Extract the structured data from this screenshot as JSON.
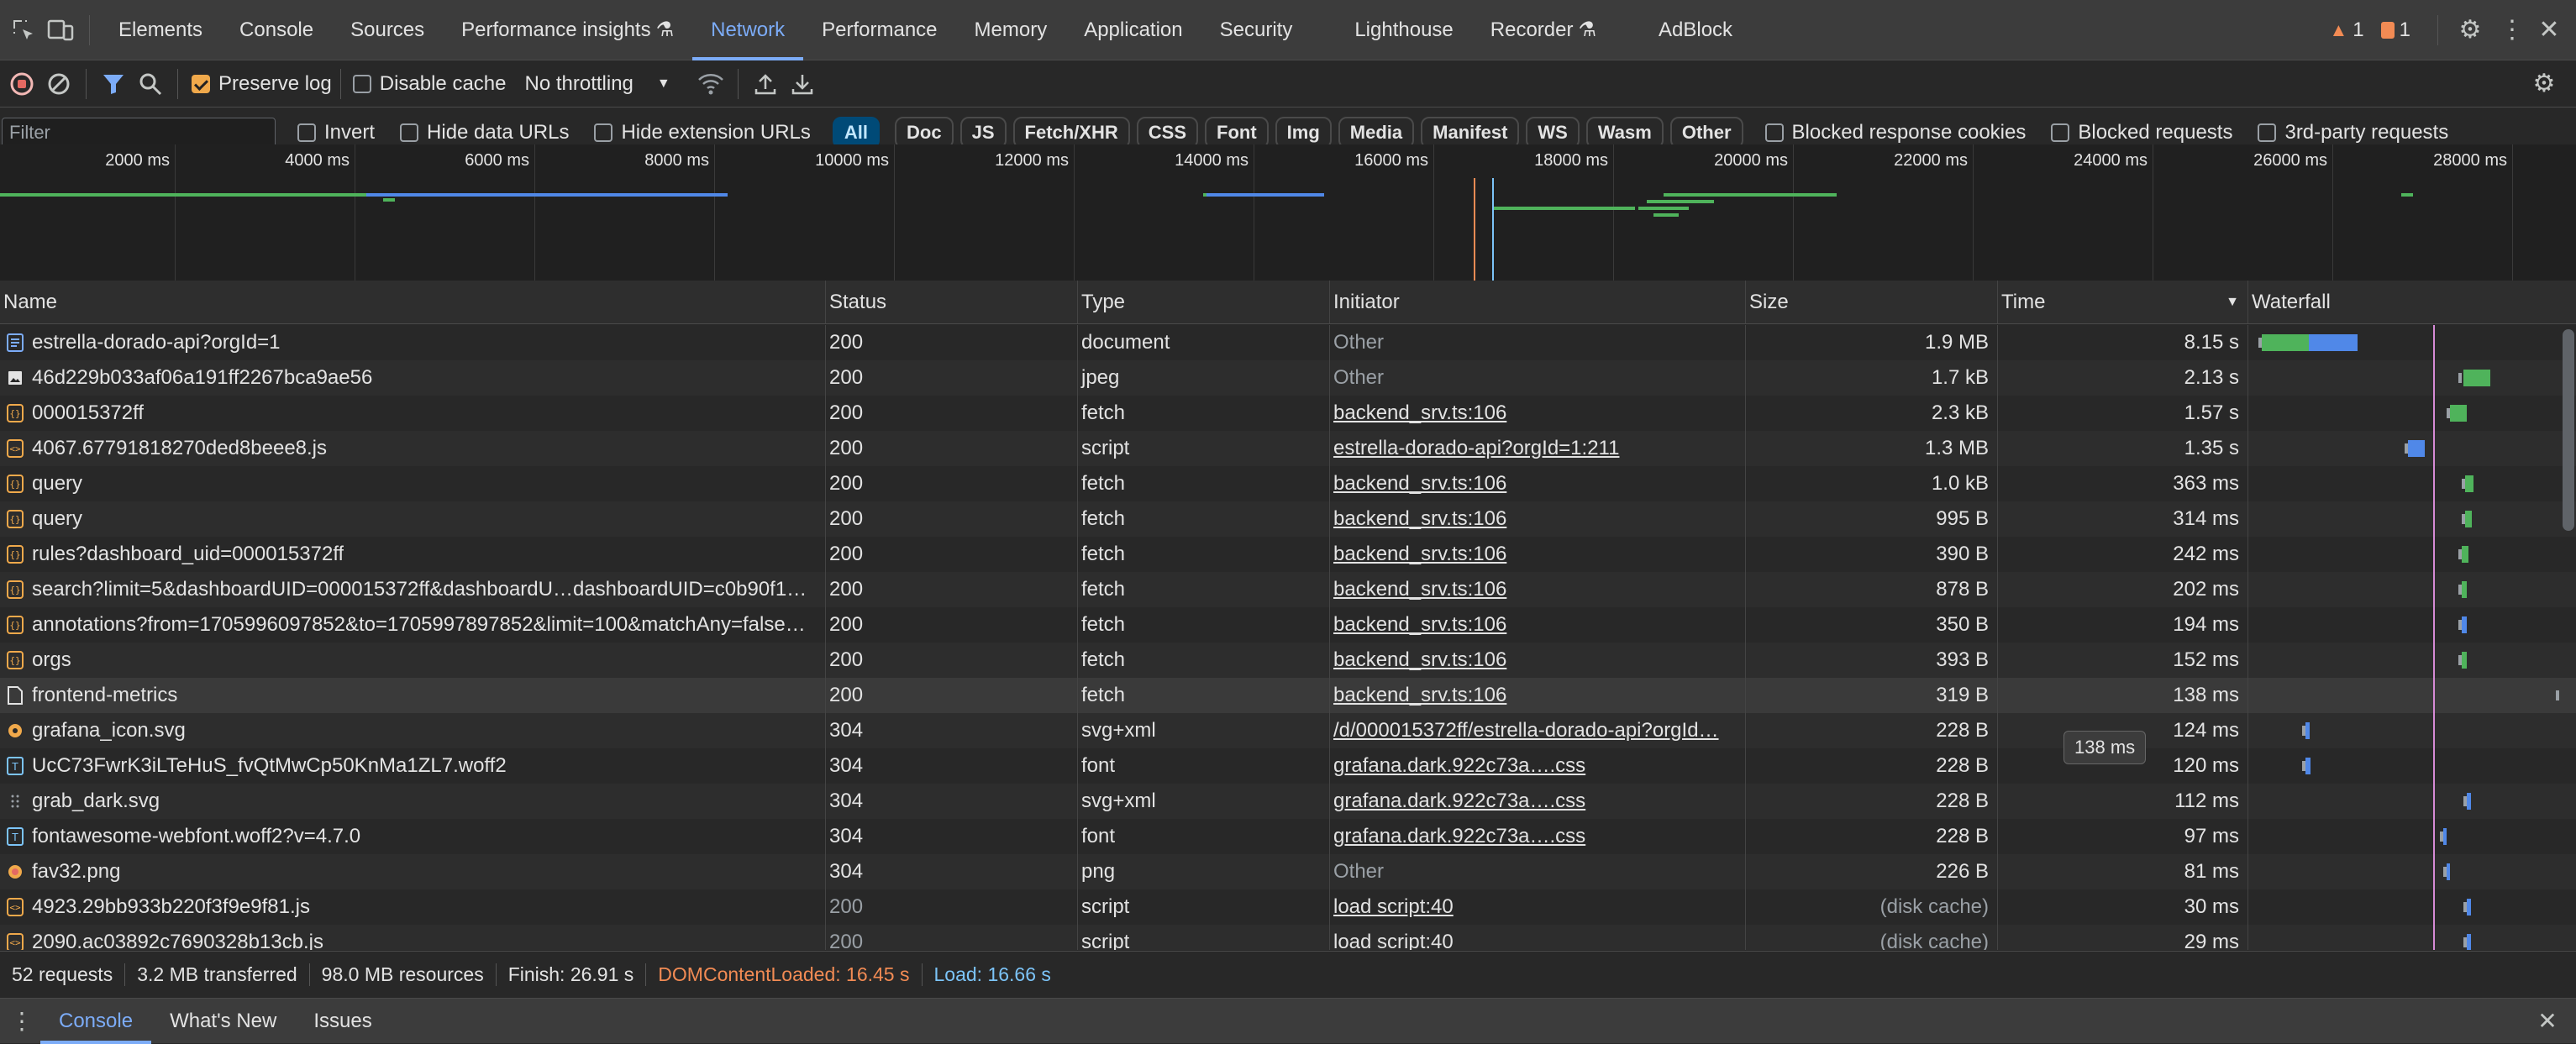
{
  "tabs": [
    "Elements",
    "Console",
    "Sources",
    "Performance insights",
    "Network",
    "Performance",
    "Memory",
    "Application",
    "Security",
    "Lighthouse",
    "Recorder",
    "AdBlock"
  ],
  "tabs_active_index": 4,
  "badges": {
    "warnings": "1",
    "issues": "1"
  },
  "toolbar": {
    "preserve_log": "Preserve log",
    "disable_cache": "Disable cache",
    "throttling": "No throttling"
  },
  "filter": {
    "placeholder": "Filter",
    "invert": "Invert",
    "hide_data": "Hide data URLs",
    "hide_ext": "Hide extension URLs",
    "types": [
      "All",
      "Doc",
      "JS",
      "Fetch/XHR",
      "CSS",
      "Font",
      "Img",
      "Media",
      "Manifest",
      "WS",
      "Wasm",
      "Other"
    ],
    "blocked_cookies": "Blocked response cookies",
    "blocked_requests": "Blocked requests",
    "third_party": "3rd-party requests"
  },
  "overview_ticks": [
    "2000 ms",
    "4000 ms",
    "6000 ms",
    "8000 ms",
    "10000 ms",
    "12000 ms",
    "14000 ms",
    "16000 ms",
    "18000 ms",
    "20000 ms",
    "22000 ms",
    "24000 ms",
    "26000 ms",
    "28000 ms"
  ],
  "columns": {
    "name": "Name",
    "status": "Status",
    "type": "Type",
    "initiator": "Initiator",
    "size": "Size",
    "time": "Time",
    "waterfall": "Waterfall"
  },
  "rows": [
    {
      "icon": "document-icon",
      "name": "estrella-dorado-api?orgId=1",
      "status": "200",
      "type": "document",
      "initiator": "Other",
      "init_link": false,
      "size": "1.9 MB",
      "time": "8.15 s"
    },
    {
      "icon": "image-icon",
      "name": "46d229b033af06a191ff2267bca9ae56",
      "status": "200",
      "type": "jpeg",
      "initiator": "Other",
      "init_link": false,
      "size": "1.7 kB",
      "time": "2.13 s"
    },
    {
      "icon": "fetch-icon",
      "name": "000015372ff",
      "status": "200",
      "type": "fetch",
      "initiator": "backend_srv.ts:106",
      "init_link": true,
      "size": "2.3 kB",
      "time": "1.57 s"
    },
    {
      "icon": "script-icon",
      "name": "4067.67791818270ded8beee8.js",
      "status": "200",
      "type": "script",
      "initiator": "estrella-dorado-api?orgId=1:211",
      "init_link": true,
      "size": "1.3 MB",
      "time": "1.35 s"
    },
    {
      "icon": "fetch-icon",
      "name": "query",
      "status": "200",
      "type": "fetch",
      "initiator": "backend_srv.ts:106",
      "init_link": true,
      "size": "1.0 kB",
      "time": "363 ms"
    },
    {
      "icon": "fetch-icon",
      "name": "query",
      "status": "200",
      "type": "fetch",
      "initiator": "backend_srv.ts:106",
      "init_link": true,
      "size": "995 B",
      "time": "314 ms"
    },
    {
      "icon": "fetch-icon",
      "name": "rules?dashboard_uid=000015372ff",
      "status": "200",
      "type": "fetch",
      "initiator": "backend_srv.ts:106",
      "init_link": true,
      "size": "390 B",
      "time": "242 ms"
    },
    {
      "icon": "fetch-icon",
      "name": "search?limit=5&dashboardUID=000015372ff&dashboardU…dashboardUID=c0b90f1…",
      "status": "200",
      "type": "fetch",
      "initiator": "backend_srv.ts:106",
      "init_link": true,
      "size": "878 B",
      "time": "202 ms"
    },
    {
      "icon": "fetch-icon",
      "name": "annotations?from=1705996097852&to=1705997897852&limit=100&matchAny=false…",
      "status": "200",
      "type": "fetch",
      "initiator": "backend_srv.ts:106",
      "init_link": true,
      "size": "350 B",
      "time": "194 ms"
    },
    {
      "icon": "fetch-icon",
      "name": "orgs",
      "status": "200",
      "type": "fetch",
      "initiator": "backend_srv.ts:106",
      "init_link": true,
      "size": "393 B",
      "time": "152 ms"
    },
    {
      "icon": "blank-document-icon",
      "name": "frontend-metrics",
      "status": "200",
      "type": "fetch",
      "initiator": "backend_srv.ts:106",
      "init_link": true,
      "size": "319 B",
      "time": "138 ms"
    },
    {
      "icon": "svg-image-icon",
      "name": "grafana_icon.svg",
      "status": "304",
      "type": "svg+xml",
      "initiator": "/d/000015372ff/estrella-dorado-api?orgId…",
      "init_link": true,
      "size": "228 B",
      "time": "124 ms"
    },
    {
      "icon": "font-icon",
      "name": "UcC73FwrK3iLTeHuS_fvQtMwCp50KnMa1ZL7.woff2",
      "status": "304",
      "type": "font",
      "initiator": "grafana.dark.922c73a….css",
      "init_link": true,
      "size": "228 B",
      "time": "120 ms"
    },
    {
      "icon": "dotted-image-icon",
      "name": "grab_dark.svg",
      "status": "304",
      "type": "svg+xml",
      "initiator": "grafana.dark.922c73a….css",
      "init_link": true,
      "size": "228 B",
      "time": "112 ms"
    },
    {
      "icon": "font-icon",
      "name": "fontawesome-webfont.woff2?v=4.7.0",
      "status": "304",
      "type": "font",
      "initiator": "grafana.dark.922c73a….css",
      "init_link": true,
      "size": "228 B",
      "time": "97 ms"
    },
    {
      "icon": "png-image-icon",
      "name": "fav32.png",
      "status": "304",
      "type": "png",
      "initiator": "Other",
      "init_link": false,
      "size": "226 B",
      "time": "81 ms"
    },
    {
      "icon": "script-icon",
      "name": "4923.29bb933b220f3f9e9f81.js",
      "status": "200",
      "type": "script",
      "initiator": "load script:40",
      "init_link": true,
      "size": "(disk cache)",
      "time": "30 ms"
    },
    {
      "icon": "script-icon",
      "name": "2090.ac03892c7690328b13cb.js",
      "status": "200",
      "type": "script",
      "initiator": "load script:40",
      "init_link": true,
      "size": "(disk cache)",
      "time": "29 ms"
    }
  ],
  "selected_row": 10,
  "tooltip": "138 ms",
  "status": {
    "requests": "52 requests",
    "transferred": "3.2 MB transferred",
    "resources": "98.0 MB resources",
    "finish": "Finish: 26.91 s",
    "dcl": "DOMContentLoaded: 16.45 s",
    "load": "Load: 16.66 s"
  },
  "drawer_tabs": [
    "Console",
    "What's New",
    "Issues"
  ],
  "colors": {
    "accent": "#7cacf8",
    "dcl": "#f28b54",
    "load": "#7cc4f8",
    "waiting": "#4fb35b",
    "download": "#5088e8"
  }
}
